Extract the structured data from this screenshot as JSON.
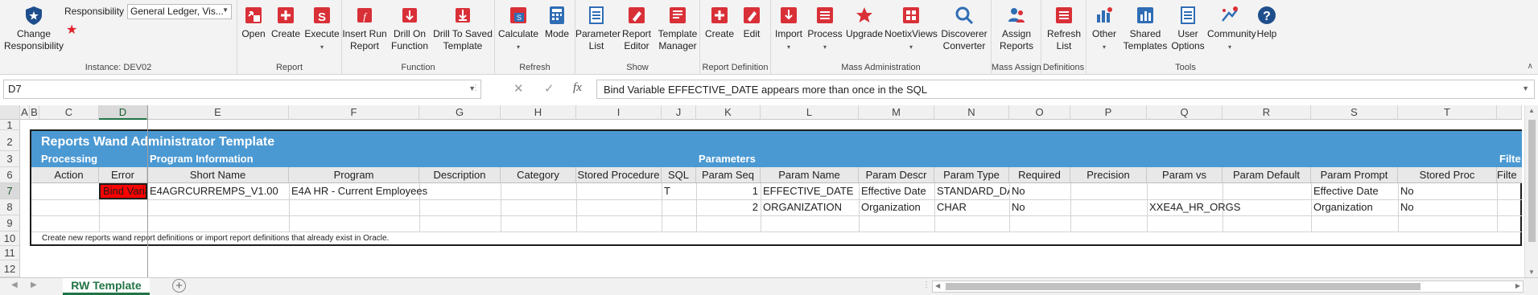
{
  "ribbon": {
    "responsibility_label": "Responsibility",
    "responsibility_value": "General Ledger, Vis...",
    "change_responsibility": "Change Responsibility",
    "instance_label": "Instance: DEV02",
    "report": {
      "open": "Open",
      "create": "Create",
      "execute": "Execute",
      "group": "Report"
    },
    "function": {
      "insert_run": "Insert Run Report",
      "drill_on": "Drill On Function",
      "drill_saved": "Drill To Saved Template",
      "group": "Function"
    },
    "refresh": {
      "calculate": "Calculate",
      "mode": "Mode",
      "group": "Refresh"
    },
    "show": {
      "parameter_list": "Parameter List",
      "report_editor": "Report Editor",
      "template_manager": "Template Manager",
      "group": "Show"
    },
    "report_definition": {
      "create": "Create",
      "edit": "Edit",
      "group": "Report Definition"
    },
    "mass_admin": {
      "import": "Import",
      "process": "Process",
      "upgrade": "Upgrade",
      "noetixviews": "NoetixViews",
      "discoverer": "Discoverer Converter",
      "group": "Mass Administration"
    },
    "mass_assign": {
      "assign_reports": "Assign Reports",
      "group": "Mass Assign"
    },
    "definitions": {
      "refresh_list": "Refresh List",
      "group": "Definitions"
    },
    "tools": {
      "other": "Other",
      "shared_templates": "Shared Templates",
      "user_options": "User Options",
      "community": "Community",
      "help": "Help",
      "group": "Tools"
    }
  },
  "formula_bar": {
    "name_box": "D7",
    "formula": "Bind Variable EFFECTIVE_DATE appears more than once in the SQL"
  },
  "sheet": {
    "columns": [
      "A",
      "B",
      "C",
      "D",
      "E",
      "F",
      "G",
      "H",
      "I",
      "J",
      "K",
      "L",
      "M",
      "N",
      "O",
      "P",
      "Q",
      "R",
      "S",
      "T"
    ],
    "rows": [
      "1",
      "2",
      "3",
      "6",
      "7",
      "8",
      "9",
      "10",
      "11",
      "12"
    ],
    "title": "Reports Wand Administrator Template",
    "section_processing": "Processing",
    "section_program": "Program Information",
    "section_parameters": "Parameters",
    "section_filter": "Filte",
    "headers": [
      "Action",
      "Error",
      "Short Name",
      "Program",
      "Description",
      "Category",
      "Stored Procedure",
      "SQL",
      "Param Seq",
      "Param Name",
      "Param Descr",
      "Param Type",
      "Required",
      "Precision",
      "Param vs",
      "Param Default",
      "Param Prompt",
      "Stored Proc",
      "Filte"
    ],
    "row7": {
      "error": "Bind Varia",
      "short_name": "E4AGRCURREMPS_V1.00",
      "program": "E4A HR - Current Employees",
      "sql": "T",
      "seq": "1",
      "name": "EFFECTIVE_DATE",
      "descr": "Effective Date",
      "type": "STANDARD_DAT",
      "required": "No",
      "prompt": "Effective Date",
      "stored": "No"
    },
    "row8": {
      "seq": "2",
      "name": "ORGANIZATION",
      "descr": "Organization",
      "type": "CHAR",
      "required": "No",
      "vs": "XXE4A_HR_ORGS",
      "prompt": "Organization",
      "stored": "No"
    },
    "footnote": "Create new reports wand report definitions or import report definitions that already exist in Oracle."
  },
  "tabs": {
    "active": "RW Template"
  }
}
